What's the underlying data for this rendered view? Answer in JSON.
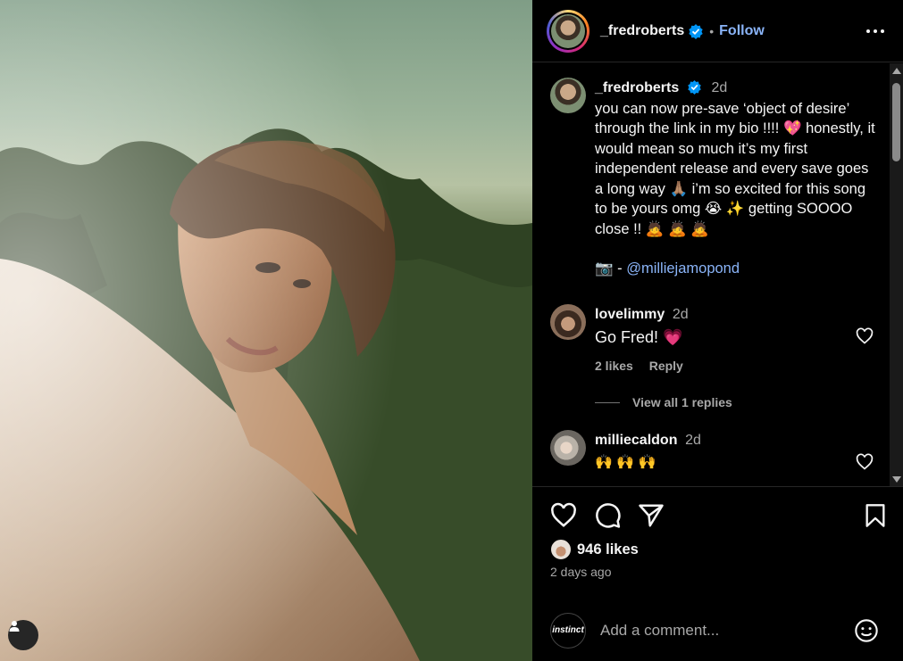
{
  "post": {
    "author": "_fredroberts",
    "follow_label": "Follow",
    "separator": "•"
  },
  "caption": {
    "username": "_fredroberts",
    "time": "2d",
    "text": "you can now pre-save ‘object of desire’ through the link in my bio !!!! 💖 honestly, it would mean so much it’s my first independent release and every save goes a long way 🙏🏽 i’m so excited for this song to be yours omg 😭 ✨ getting SOOOO close !! 🙇 🙇 🙇",
    "credit_prefix": "📷 - ",
    "credit_mention": "@milliejamopond"
  },
  "comments": [
    {
      "username": "lovelimmy",
      "time": "2d",
      "text": "Go Fred! 💗",
      "likes": "2 likes",
      "reply": "Reply"
    },
    {
      "username": "milliecaldon",
      "time": "2d",
      "text": "🙌 🙌 🙌"
    }
  ],
  "view_replies": "View all 1 replies",
  "likes_count": "946 likes",
  "posted": "2 days ago",
  "add_comment": {
    "placeholder": "Add a comment...",
    "avatar_label": "instinct"
  },
  "icons": [
    "heart-icon",
    "comment-icon",
    "share-icon",
    "bookmark-icon",
    "verified-icon",
    "more-icon",
    "emoji-icon",
    "user-tag-icon"
  ],
  "colors": {
    "link": "#8ab4f8",
    "verified": "#0095f6",
    "muted": "#a8a8a8"
  }
}
